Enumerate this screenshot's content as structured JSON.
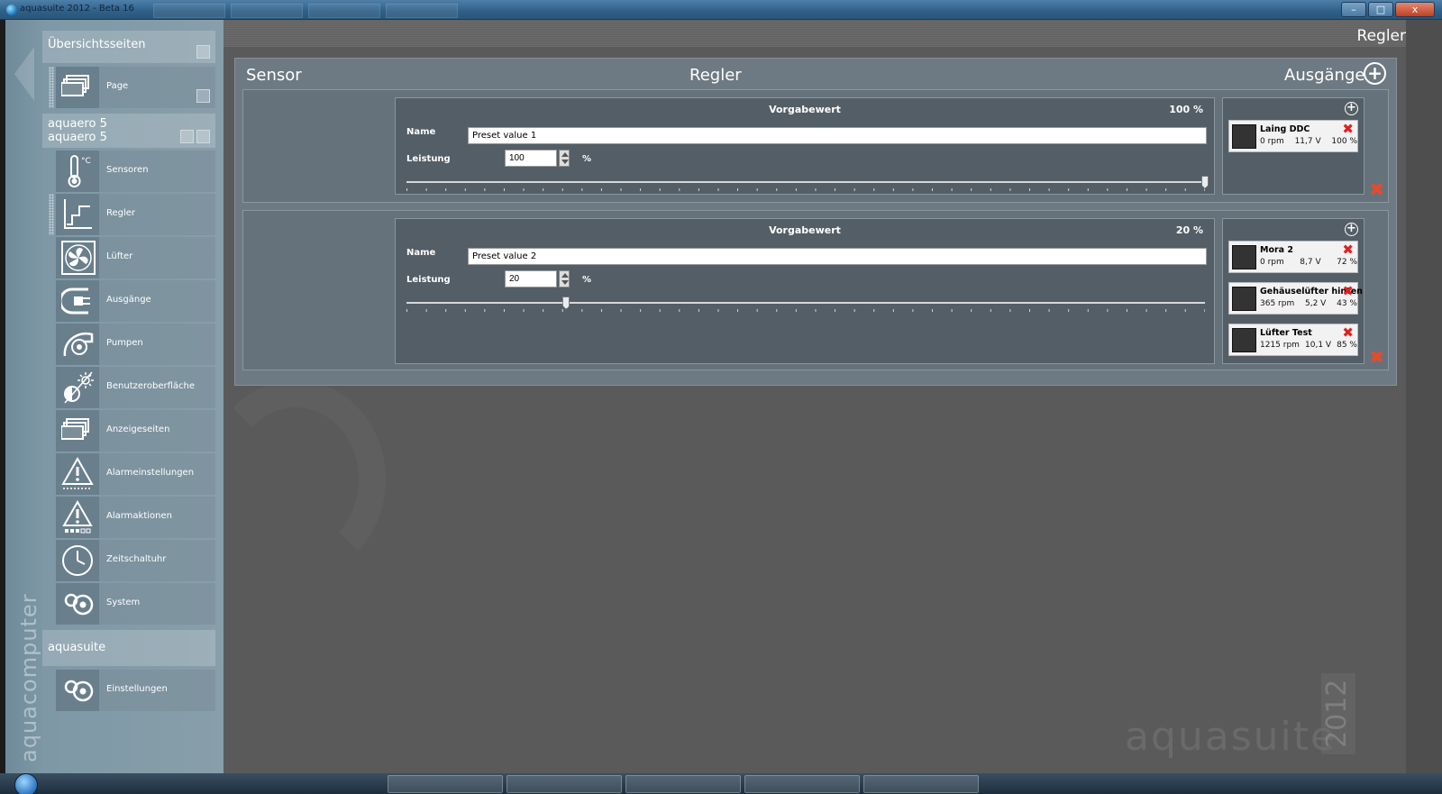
{
  "window": {
    "title": "aquasuite 2012 - Beta 16",
    "minimize": "–",
    "maximize": "□",
    "close": "x"
  },
  "sidebar": {
    "brand_vertical": "aquacomputer",
    "overview": {
      "title": "Übersichtsseiten",
      "items": [
        {
          "label": "Page",
          "icon": "pages-icon"
        }
      ]
    },
    "device": {
      "line1": "aquaero 5",
      "line2": "aquaero 5",
      "items": [
        {
          "label": "Sensoren",
          "icon": "thermometer-icon"
        },
        {
          "label": "Regler",
          "icon": "controller-curve-icon"
        },
        {
          "label": "Lüfter",
          "icon": "fan-icon"
        },
        {
          "label": "Ausgänge",
          "icon": "plug-icon"
        },
        {
          "label": "Pumpen",
          "icon": "pump-icon"
        },
        {
          "label": "Benutzeroberfläche",
          "icon": "brightness-icon"
        },
        {
          "label": "Anzeigeseiten",
          "icon": "pages-icon"
        },
        {
          "label": "Alarmeinstellungen",
          "icon": "alarm-settings-icon"
        },
        {
          "label": "Alarmaktionen",
          "icon": "alarm-actions-icon"
        },
        {
          "label": "Zeitschaltuhr",
          "icon": "clock-icon"
        },
        {
          "label": "System",
          "icon": "system-icon"
        }
      ]
    },
    "app": {
      "title": "aquasuite",
      "items": [
        {
          "label": "Einstellungen",
          "icon": "settings-icon"
        }
      ]
    }
  },
  "main": {
    "page_label": "Regler",
    "columns": {
      "sensor": "Sensor",
      "regler": "Regler",
      "outputs": "Ausgänge",
      "add_symbol": "+"
    },
    "brand": {
      "name": "aquasuite",
      "year": "2012"
    },
    "rows": [
      {
        "title": "Vorgabewert",
        "percent_label": "100 %",
        "name_label": "Name",
        "name_value": "Preset value 1",
        "power_label": "Leistung",
        "power_value": "100",
        "unit": "%",
        "slider_value": 100,
        "outputs": [
          {
            "name": "Laing DDC",
            "rpm": "0 rpm",
            "volt": "11,7 V",
            "pct": "100 %"
          }
        ]
      },
      {
        "title": "Vorgabewert",
        "percent_label": "20 %",
        "name_label": "Name",
        "name_value": "Preset value 2",
        "power_label": "Leistung",
        "power_value": "20",
        "unit": "%",
        "slider_value": 20,
        "outputs": [
          {
            "name": "Mora 2",
            "rpm": "0 rpm",
            "volt": "8,7 V",
            "pct": "72 %"
          },
          {
            "name": "Gehäuselüfter hinten",
            "rpm": "365 rpm",
            "volt": "5,2 V",
            "pct": "43 %"
          },
          {
            "name": "Lüfter Test",
            "rpm": "1215 rpm",
            "volt": "10,1 V",
            "pct": "85 %"
          }
        ]
      }
    ],
    "delete_symbol": "✖"
  },
  "colors": {
    "delete_red": "#e02020",
    "panel": "#6e7a83",
    "sidebar": "#7e98a6"
  }
}
